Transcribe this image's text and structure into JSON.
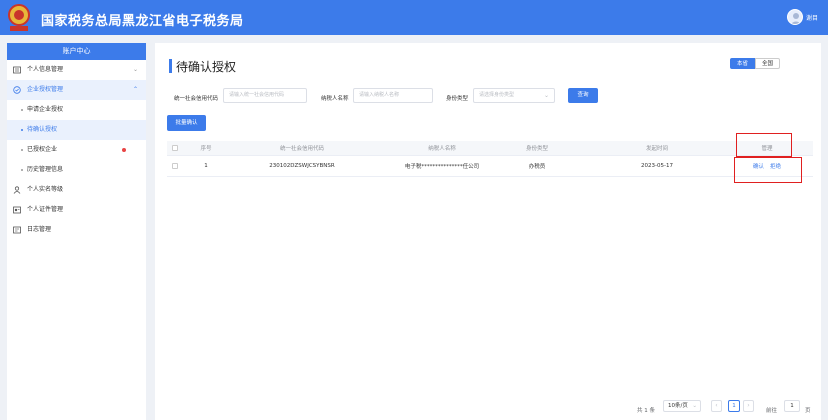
{
  "header": {
    "title": "国家税务总局黑龙江省电子税务局",
    "user_name": "谢目",
    "colors": {
      "primary": "#3c7bea"
    }
  },
  "sidebar": {
    "heading": "账户中心",
    "items": [
      {
        "label": "个人信息管理",
        "icon": "id-card-icon"
      },
      {
        "label": "企业授权管理",
        "icon": "shield-check-icon"
      },
      {
        "label": "个人实名等级",
        "icon": "person-icon"
      },
      {
        "label": "个人证件管理",
        "icon": "certificate-icon"
      },
      {
        "label": "日志管理",
        "icon": "log-icon"
      }
    ],
    "sub_items": [
      {
        "label": "申请企业授权"
      },
      {
        "label": "待确认授权"
      },
      {
        "label": "已授权企业"
      },
      {
        "label": "历史管理信息"
      }
    ]
  },
  "main": {
    "title": "待确认授权",
    "scope_toggle": {
      "current": "本省",
      "all": "全国"
    },
    "filters": {
      "credit_code": {
        "label": "统一社会信用代码",
        "placeholder": "请输入统一社会信用代码"
      },
      "taxpayer_name": {
        "label": "纳税人名称",
        "placeholder": "请输入纳税人名称"
      },
      "identity_type": {
        "label": "身份类型",
        "placeholder": "请选择身份类型"
      },
      "query_button": "查询"
    },
    "batch_confirm_button": "批量确认",
    "table": {
      "columns": [
        "序号",
        "统一社会信用代码",
        "纳税人名称",
        "身份类型",
        "发起时间",
        "管理"
      ],
      "rows": [
        {
          "index": "1",
          "credit_code": "230102DZSWJCSYBNSR",
          "taxpayer_name": "电子税***************任公司",
          "identity_type": "办税员",
          "start_time": "2023-05-17",
          "actions": [
            "确认",
            "拒绝"
          ]
        }
      ]
    },
    "pagination": {
      "total": "共 1 条",
      "page_size": "10条/页",
      "prev": "‹",
      "current_page": "1",
      "next": "›",
      "goto_label": "前往",
      "goto_value": "1",
      "page_unit": "页"
    }
  }
}
